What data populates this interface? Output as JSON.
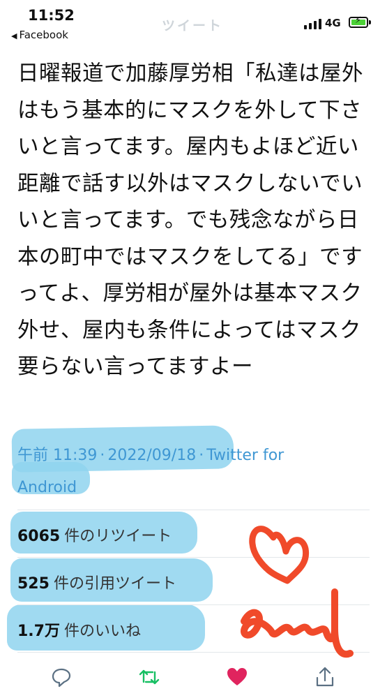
{
  "status_bar": {
    "time": "11:52",
    "back_app": "Facebook",
    "header_title": "ツイート",
    "network": "4G"
  },
  "tweet": {
    "text": "日曜報道で加藤厚労相「私達は屋外はもう基本的にマスクを外して下さいと言ってます。屋内もよほど近い距離で話す以外はマスクしないでいいと言ってます。でも残念ながら日本の町中ではマスクをしてる」ですってよ、厚労相が屋外は基本マスク外せ、屋内も条件によってはマスク要らない言ってますよー",
    "time": "午前 11:39",
    "date": "2022/09/18",
    "source": "Twitter for Android"
  },
  "stats": {
    "retweets": {
      "count": "6065",
      "label": "件のリツイート"
    },
    "quotes": {
      "count": "525",
      "label": "件の引用ツイート"
    },
    "likes": {
      "count": "1.7万",
      "label": "件のいいね"
    }
  },
  "colors": {
    "link": "#3f97d3",
    "highlight": "#8fd4ee",
    "retweet_green": "#17bf63",
    "like_pink": "#e0245e",
    "scribble": "#f04a2a"
  },
  "icons": [
    "reply-icon",
    "retweet-icon",
    "like-icon",
    "share-icon"
  ]
}
